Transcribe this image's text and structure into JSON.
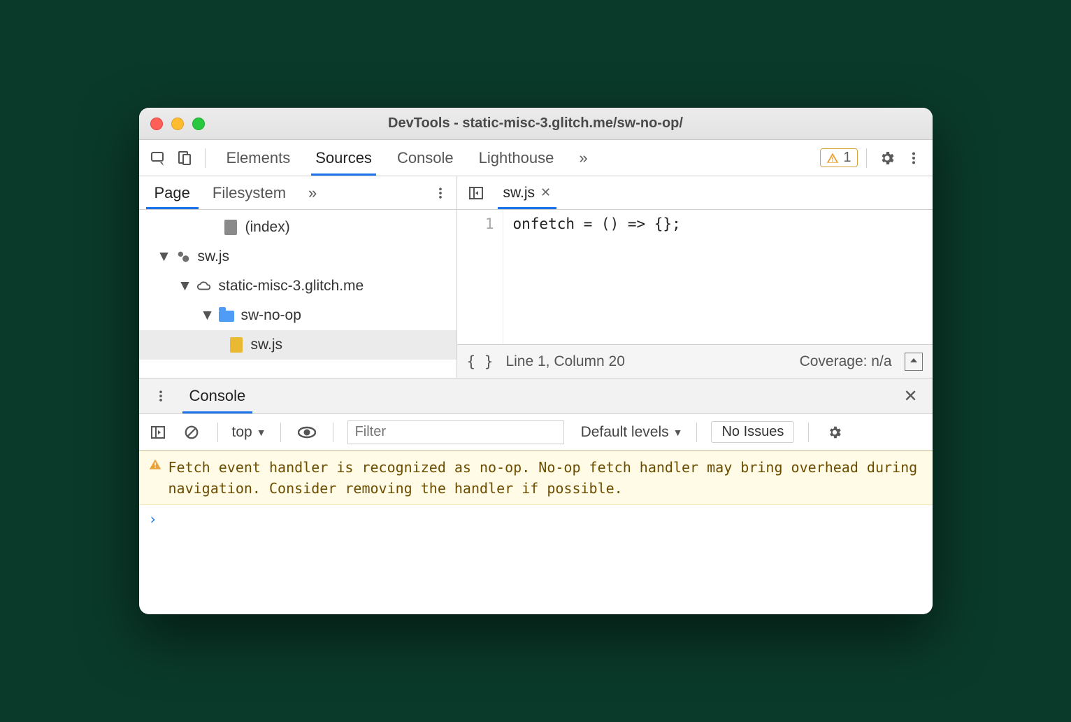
{
  "window": {
    "title": "DevTools - static-misc-3.glitch.me/sw-no-op/"
  },
  "toolbar": {
    "tabs": [
      "Elements",
      "Sources",
      "Console",
      "Lighthouse"
    ],
    "active_tab": "Sources",
    "warning_count": "1"
  },
  "sources": {
    "subtabs": [
      "Page",
      "Filesystem"
    ],
    "active_subtab": "Page",
    "open_file": {
      "name": "sw.js"
    },
    "tree": {
      "index_label": "(index)",
      "sw_label": "sw.js",
      "domain": "static-misc-3.glitch.me",
      "folder": "sw-no-op",
      "file": "sw.js"
    },
    "code": {
      "line_num": "1",
      "text": "onfetch = () => {};"
    },
    "status": {
      "position": "Line 1, Column 20",
      "coverage": "Coverage: n/a"
    }
  },
  "drawer": {
    "tab": "Console"
  },
  "console_toolbar": {
    "context": "top",
    "filter_placeholder": "Filter",
    "levels": "Default levels",
    "issues": "No Issues"
  },
  "console_body": {
    "warning": "Fetch event handler is recognized as no-op. No-op fetch handler may bring overhead during navigation. Consider removing the handler if possible.",
    "prompt": "›"
  }
}
